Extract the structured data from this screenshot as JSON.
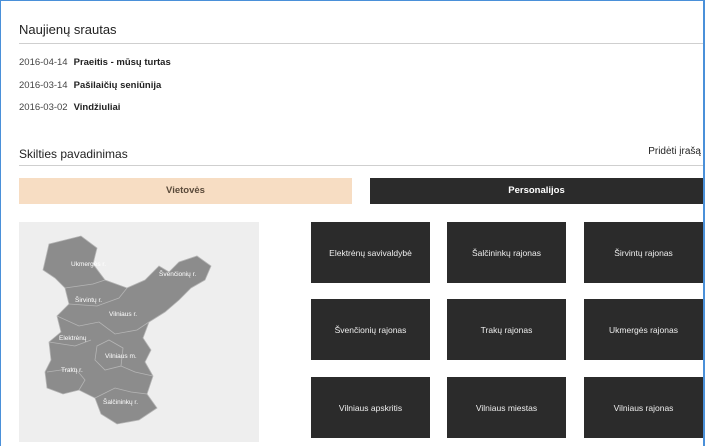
{
  "news": {
    "title": "Naujienų srautas",
    "items": [
      {
        "date": "2016-04-14",
        "title": "Praeitis - mūsų turtas"
      },
      {
        "date": "2016-03-14",
        "title": "Pašilaičių seniūnija"
      },
      {
        "date": "2016-03-02",
        "title": "Vindžiuliai"
      }
    ]
  },
  "section": {
    "title": "Skilties pavadinimas",
    "add_link": "Pridėti įrašą"
  },
  "tabs": [
    {
      "label": "Vietovės",
      "active": true
    },
    {
      "label": "Personalijos",
      "active": false
    }
  ],
  "map": {
    "labels": [
      "Ukmergės r.",
      "Švenčionių r.",
      "Širvintų r.",
      "Vilniaus r.",
      "Elektrėnų",
      "Vilniaus m.",
      "Trakų r.",
      "Šalčininkų r."
    ]
  },
  "tiles": [
    "Elektrėnų savivaldybė",
    "Šalčininkų rajonas",
    "Širvintų rajonas",
    "Švenčionių rajonas",
    "Trakų rajonas",
    "Ukmergės rajonas",
    "Vilniaus apskritis",
    "Vilniaus miestas",
    "Vilniaus rajonas"
  ],
  "colors": {
    "tab_active_bg": "#f7ddc3",
    "tile_bg": "#2b2b2b",
    "map_fill": "#8c8c8c",
    "frame_border": "#4a90d9"
  }
}
